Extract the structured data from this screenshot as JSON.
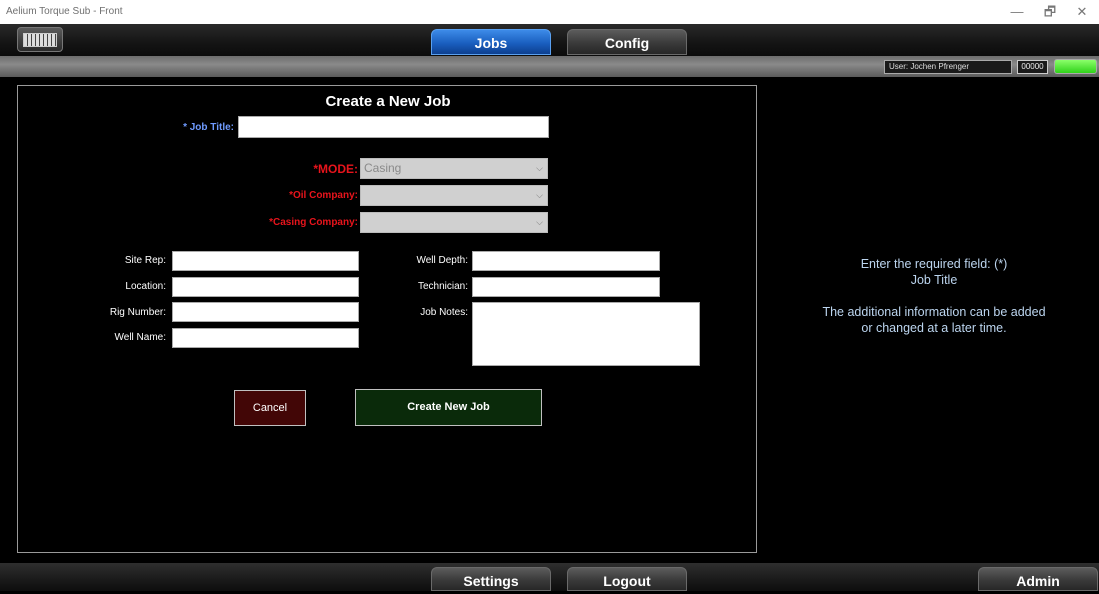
{
  "window": {
    "title": "Aelium Torque Sub - Front",
    "minimize": "—",
    "restore": "🗗",
    "close": "✕"
  },
  "nav": {
    "tabs": [
      {
        "label": "Jobs",
        "active": true
      },
      {
        "label": "Config",
        "active": false
      }
    ]
  },
  "status": {
    "user": "User: Jochen Pfrenger",
    "counter": "00000",
    "indicator_color": "#2fd21a"
  },
  "form": {
    "heading": "Create a New Job",
    "job_title_label": "* Job Title:",
    "job_title_value": "",
    "mode_label": "*MODE:",
    "mode_value": "Casing",
    "oil_company_label": "*Oil Company:",
    "oil_company_value": "",
    "casing_company_label": "*Casing Company:",
    "casing_company_value": "",
    "site_rep_label": "Site Rep:",
    "location_label": "Location:",
    "rig_number_label": "Rig Number:",
    "well_name_label": "Well Name:",
    "well_depth_label": "Well Depth:",
    "technician_label": "Technician:",
    "job_notes_label": "Job Notes:",
    "cancel_label": "Cancel",
    "create_label": "Create New Job"
  },
  "info": {
    "line1": "Enter the required field: (*)",
    "line2": "Job Title",
    "line3": "The additional information can be added",
    "line4": "or changed at a later time."
  },
  "bottom": {
    "settings_label": "Settings",
    "logout_label": "Logout",
    "admin_label": "Admin"
  }
}
